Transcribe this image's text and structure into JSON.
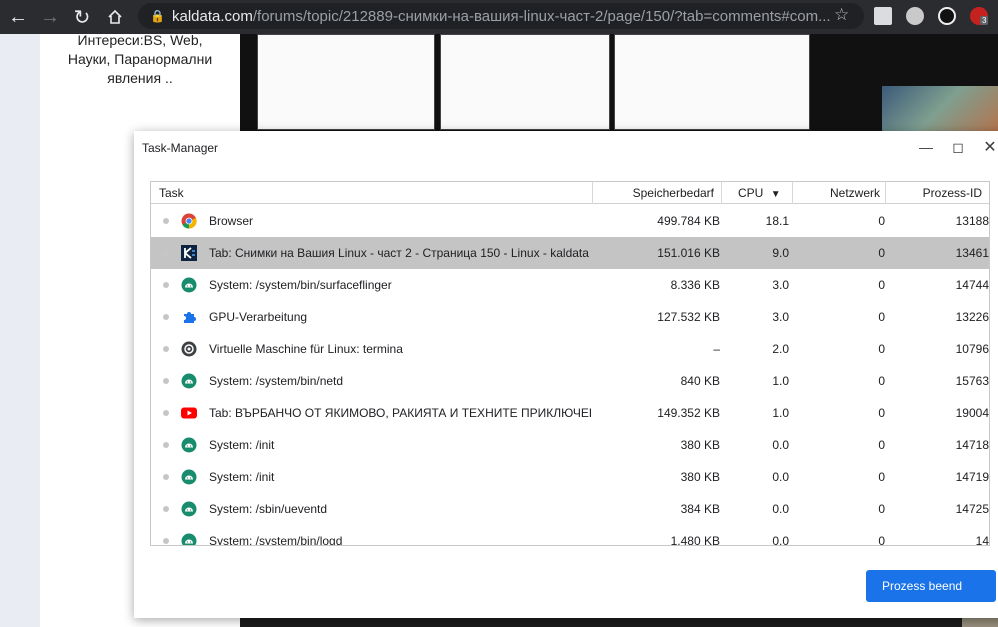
{
  "browser": {
    "url_host": "kaldata.com",
    "url_path": "/forums/topic/212889-снимки-на-вашия-linux-част-2/page/150/?tab=comments#com...",
    "ext_badge": "3"
  },
  "page": {
    "interests": "Интереси:BS, Web, Науки, Паранормални явления .."
  },
  "task_manager": {
    "title": "Task-Manager",
    "columns": {
      "task": "Task",
      "memory": "Speicherbedarf",
      "cpu": "CPU",
      "network": "Netzwerk",
      "pid": "Prozess-ID"
    },
    "sort_indicator": "▼",
    "rows": [
      {
        "icon": "chrome-icon",
        "task": "Browser",
        "memory": "499.784 KB",
        "cpu": "18.1",
        "network": "0",
        "pid": "13188"
      },
      {
        "icon": "kaldata-favicon-icon",
        "task": "Tab: Снимки на Вашия Linux - част 2 - Страница 150 - Linux - kaldata",
        "memory": "151.016 KB",
        "cpu": "9.0",
        "network": "0",
        "pid": "13461"
      },
      {
        "icon": "android-icon",
        "task": "System: /system/bin/surfaceflinger",
        "memory": "8.336 KB",
        "cpu": "3.0",
        "network": "0",
        "pid": "14744"
      },
      {
        "icon": "puzzle-icon",
        "task": "GPU-Verarbeitung",
        "memory": "127.532 KB",
        "cpu": "3.0",
        "network": "0",
        "pid": "13226"
      },
      {
        "icon": "crostini-icon",
        "task": "Virtuelle Maschine für Linux: termina",
        "memory": "–",
        "cpu": "2.0",
        "network": "0",
        "pid": "10796"
      },
      {
        "icon": "android-icon",
        "task": "System: /system/bin/netd",
        "memory": "840 KB",
        "cpu": "1.0",
        "network": "0",
        "pid": "15763"
      },
      {
        "icon": "youtube-icon",
        "task": "Tab: ВЪРБАНЧО ОТ ЯКИМОВО, РАКИЯТА И ТЕХНИТЕ ПРИКЛЮЧЕНИ",
        "memory": "149.352 KB",
        "cpu": "1.0",
        "network": "0",
        "pid": "19004"
      },
      {
        "icon": "android-icon",
        "task": "System: /init",
        "memory": "380 KB",
        "cpu": "0.0",
        "network": "0",
        "pid": "14718"
      },
      {
        "icon": "android-icon",
        "task": "System: /init",
        "memory": "380 KB",
        "cpu": "0.0",
        "network": "0",
        "pid": "14719"
      },
      {
        "icon": "android-icon",
        "task": "System: /sbin/ueventd",
        "memory": "384 KB",
        "cpu": "0.0",
        "network": "0",
        "pid": "14725"
      },
      {
        "icon": "android-icon",
        "task": "System: /system/bin/logd",
        "memory": "1.480 KB",
        "cpu": "0.0",
        "network": "0",
        "pid": "14"
      }
    ],
    "end_button": "Prozess beend"
  },
  "colors": {
    "accent": "#1a73e8",
    "selected_row": "#c4c4c4"
  }
}
